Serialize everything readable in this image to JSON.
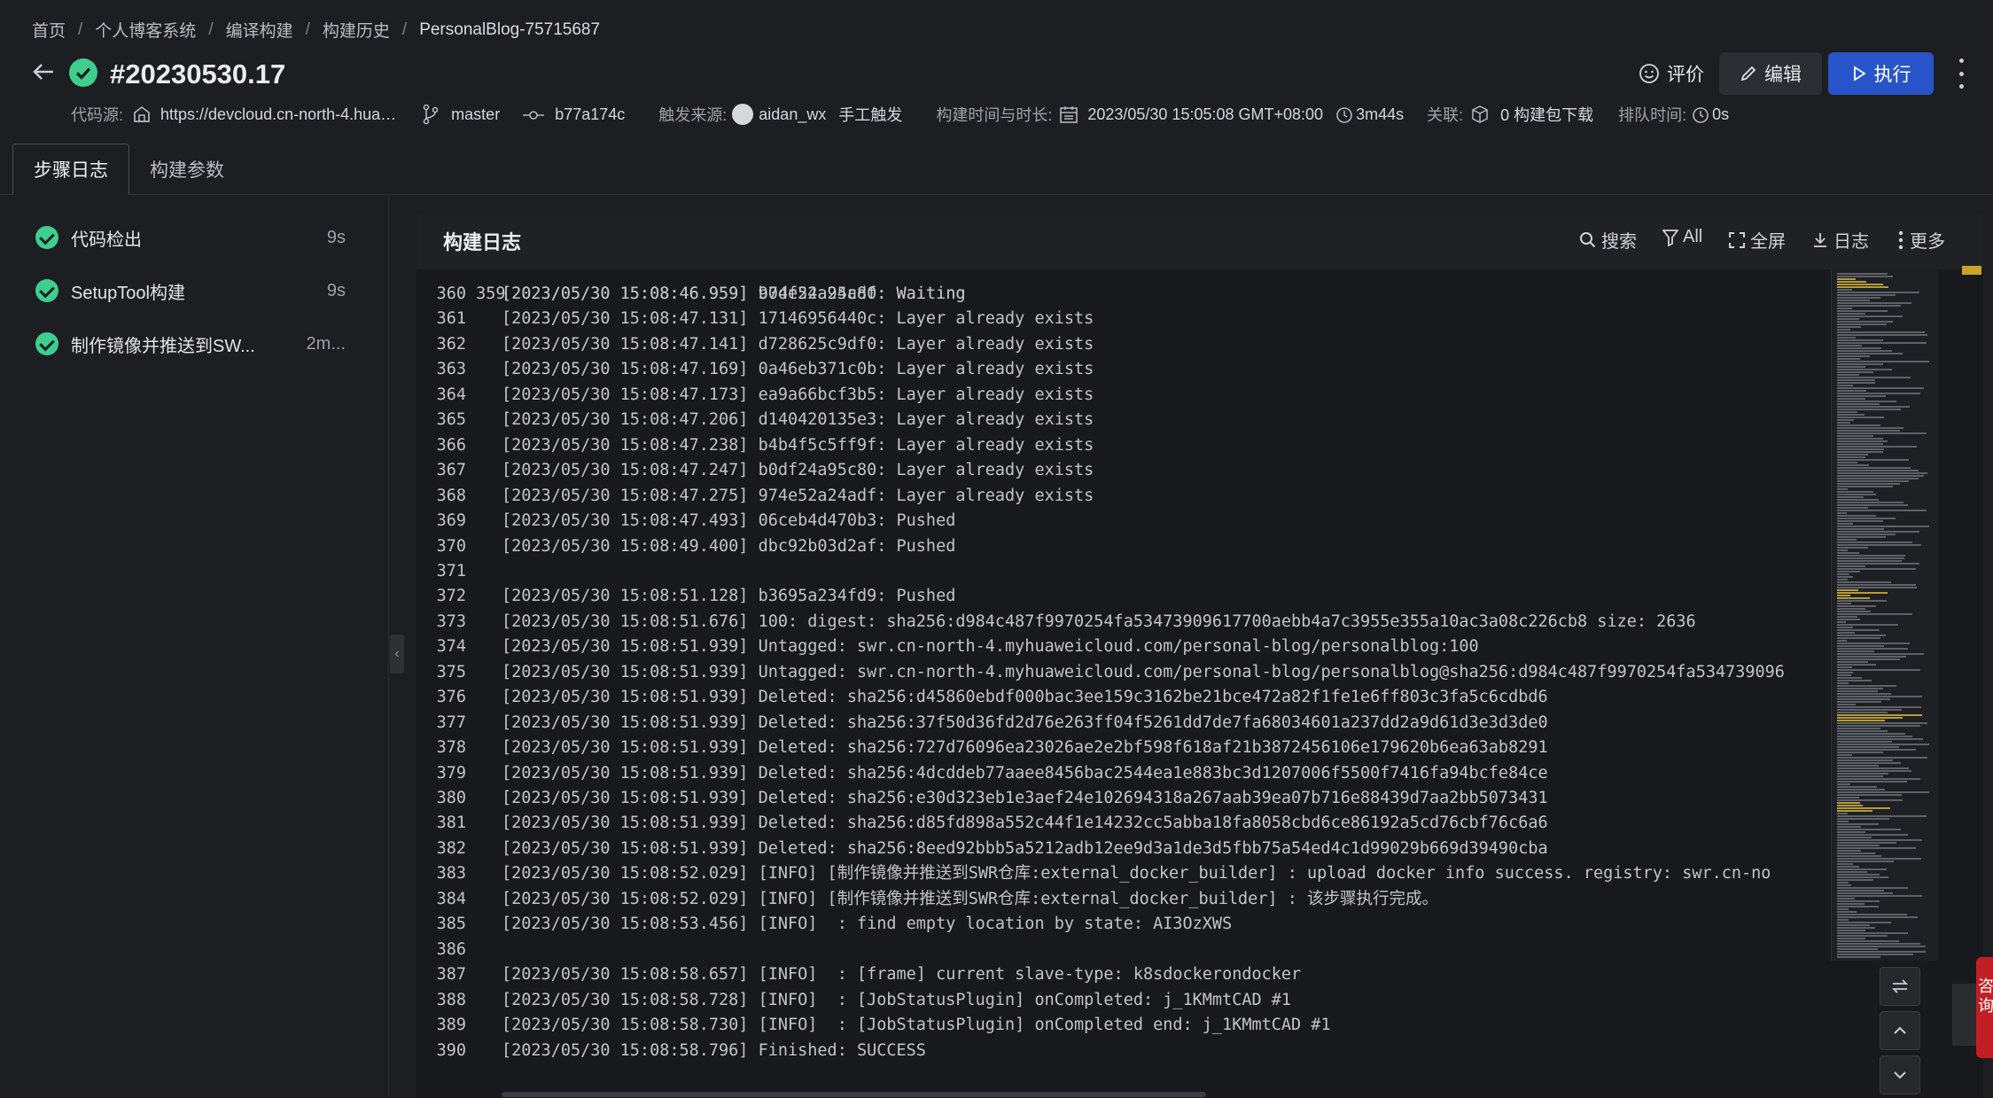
{
  "breadcrumb": {
    "items": [
      "首页",
      "个人博客系统",
      "编译构建",
      "构建历史"
    ],
    "separator": "/",
    "current": "PersonalBlog-75715687"
  },
  "header": {
    "title": "#20230530.17",
    "actions": {
      "rate": "评价",
      "edit": "编辑",
      "run": "执行"
    }
  },
  "meta": {
    "source_label": "代码源:",
    "source_value": "https://devcloud.cn-north-4.hua…",
    "branch": "master",
    "commit": "b77a174c",
    "trigger_label": "触发来源:",
    "trigger_user": "aidan_wx",
    "trigger_type": "手工触发",
    "build_time_label": "构建时间与时长:",
    "build_time": "2023/05/30 15:05:08 GMT+08:00",
    "duration": "3m44s",
    "related_label": "关联:",
    "packages": "0 构建包下载",
    "queue_label": "排队时间:",
    "queue_time": "0s"
  },
  "tabs": [
    "步骤日志",
    "构建参数"
  ],
  "steps": [
    {
      "name": "代码检出",
      "duration": "9s"
    },
    {
      "name": "SetupTool构建",
      "duration": "9s"
    },
    {
      "name": "制作镜像并推送到SW...",
      "duration": "2m..."
    }
  ],
  "log": {
    "title": "构建日志",
    "tools": {
      "search": "搜索",
      "filter": "All",
      "fullscreen": "全屏",
      "download": "日志",
      "more": "更多"
    },
    "partial_top": {
      "no": "359",
      "text": "[2023/05/30 15:08:46.959] 974e52a24adf: Waiting"
    },
    "lines": [
      {
        "no": "360",
        "text": "[2023/05/30 15:08:46.959] b0df24a95c80: Waiting"
      },
      {
        "no": "361",
        "text": "[2023/05/30 15:08:47.131] 17146956440c: Layer already exists"
      },
      {
        "no": "362",
        "text": "[2023/05/30 15:08:47.141] d728625c9df0: Layer already exists"
      },
      {
        "no": "363",
        "text": "[2023/05/30 15:08:47.169] 0a46eb371c0b: Layer already exists"
      },
      {
        "no": "364",
        "text": "[2023/05/30 15:08:47.173] ea9a66bcf3b5: Layer already exists"
      },
      {
        "no": "365",
        "text": "[2023/05/30 15:08:47.206] d140420135e3: Layer already exists"
      },
      {
        "no": "366",
        "text": "[2023/05/30 15:08:47.238] b4b4f5c5ff9f: Layer already exists"
      },
      {
        "no": "367",
        "text": "[2023/05/30 15:08:47.247] b0df24a95c80: Layer already exists"
      },
      {
        "no": "368",
        "text": "[2023/05/30 15:08:47.275] 974e52a24adf: Layer already exists"
      },
      {
        "no": "369",
        "text": "[2023/05/30 15:08:47.493] 06ceb4d470b3: Pushed"
      },
      {
        "no": "370",
        "text": "[2023/05/30 15:08:49.400] dbc92b03d2af: Pushed"
      },
      {
        "no": "371",
        "text": ""
      },
      {
        "no": "372",
        "text": "[2023/05/30 15:08:51.128] b3695a234fd9: Pushed"
      },
      {
        "no": "373",
        "text": "[2023/05/30 15:08:51.676] 100: digest: sha256:d984c487f9970254fa53473909617700aebb4a7c3955e355a10ac3a08c226cb8 size: 2636"
      },
      {
        "no": "374",
        "text": "[2023/05/30 15:08:51.939] Untagged: swr.cn-north-4.myhuaweicloud.com/personal-blog/personalblog:100"
      },
      {
        "no": "375",
        "text": "[2023/05/30 15:08:51.939] Untagged: swr.cn-north-4.myhuaweicloud.com/personal-blog/personalblog@sha256:d984c487f9970254fa534739096"
      },
      {
        "no": "376",
        "text": "[2023/05/30 15:08:51.939] Deleted: sha256:d45860ebdf000bac3ee159c3162be21bce472a82f1fe1e6ff803c3fa5c6cdbd6"
      },
      {
        "no": "377",
        "text": "[2023/05/30 15:08:51.939] Deleted: sha256:37f50d36fd2d76e263ff04f5261dd7de7fa68034601a237dd2a9d61d3e3d3de0"
      },
      {
        "no": "378",
        "text": "[2023/05/30 15:08:51.939] Deleted: sha256:727d76096ea23026ae2e2bf598f618af21b3872456106e179620b6ea63ab8291"
      },
      {
        "no": "379",
        "text": "[2023/05/30 15:08:51.939] Deleted: sha256:4dcddeb77aaee8456bac2544ea1e883bc3d1207006f5500f7416fa94bcfe84ce"
      },
      {
        "no": "380",
        "text": "[2023/05/30 15:08:51.939] Deleted: sha256:e30d323eb1e3aef24e102694318a267aab39ea07b716e88439d7aa2bb5073431"
      },
      {
        "no": "381",
        "text": "[2023/05/30 15:08:51.939] Deleted: sha256:d85fd898a552c44f1e14232cc5abba18fa8058cbd6ce86192a5cd76cbf76c6a6"
      },
      {
        "no": "382",
        "text": "[2023/05/30 15:08:51.939] Deleted: sha256:8eed92bbb5a5212adb12ee9d3a1de3d5fbb75a54ed4c1d99029b669d39490cba"
      },
      {
        "no": "383",
        "text": "[2023/05/30 15:08:52.029] [INFO] [制作镜像并推送到SWR仓库:external_docker_builder] : upload docker info success. registry: swr.cn-no"
      },
      {
        "no": "384",
        "text": "[2023/05/30 15:08:52.029] [INFO] [制作镜像并推送到SWR仓库:external_docker_builder] : 该步骤执行完成。"
      },
      {
        "no": "385",
        "text": "[2023/05/30 15:08:53.456] [INFO]  : find empty location by state: AI3OzXWS"
      },
      {
        "no": "386",
        "text": ""
      },
      {
        "no": "387",
        "text": "[2023/05/30 15:08:58.657] [INFO]  : [frame] current slave-type: k8sdockerondocker"
      },
      {
        "no": "388",
        "text": "[2023/05/30 15:08:58.728] [INFO]  : [JobStatusPlugin] onCompleted: j_1KMmtCAD #1"
      },
      {
        "no": "389",
        "text": "[2023/05/30 15:08:58.730] [INFO]  : [JobStatusPlugin] onCompleted end: j_1KMmtCAD #1"
      },
      {
        "no": "390",
        "text": "[2023/05/30 15:08:58.796] Finished: SUCCESS"
      }
    ]
  },
  "side_float": {
    "consult_label": "咨询"
  },
  "colors": {
    "success": "#3ecf8e",
    "primary": "#2755c9",
    "background": "#1d1e22",
    "log_background": "#18191c"
  }
}
